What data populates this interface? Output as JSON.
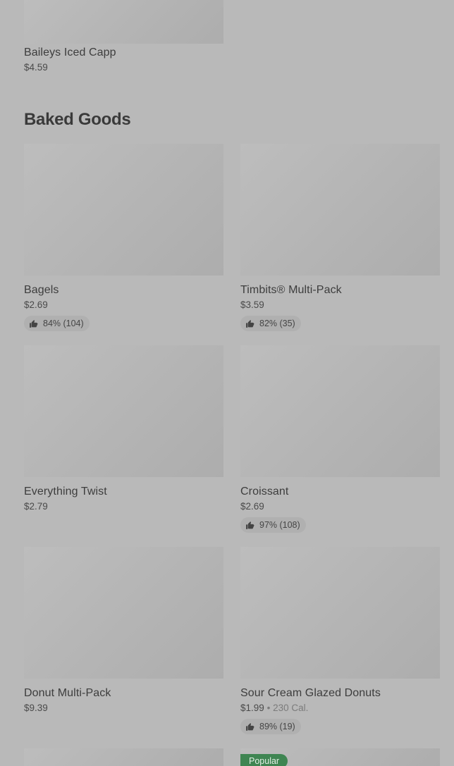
{
  "top_item": {
    "name": "Baileys Iced Capp",
    "price": "$4.59"
  },
  "section": {
    "title": "Baked Goods",
    "items": [
      {
        "name": "Bagels",
        "price": "$2.69",
        "rating": "84% (104)"
      },
      {
        "name": "Timbits® Multi-Pack",
        "price": "$3.59",
        "rating": "82% (35)"
      },
      {
        "name": "Everything Twist",
        "price": "$2.79"
      },
      {
        "name": "Croissant",
        "price": "$2.69",
        "rating": "97% (108)"
      },
      {
        "name": "Donut Multi-Pack",
        "price": "$9.39"
      },
      {
        "name": "Sour Cream Glazed Donuts",
        "price": "$1.99",
        "separator": "•",
        "calories": "230 Cal.",
        "rating": "89% (19)"
      }
    ]
  },
  "next_row": {
    "right_badge": "Popular"
  },
  "icons": {
    "rating": "thumbs-up-icon"
  }
}
